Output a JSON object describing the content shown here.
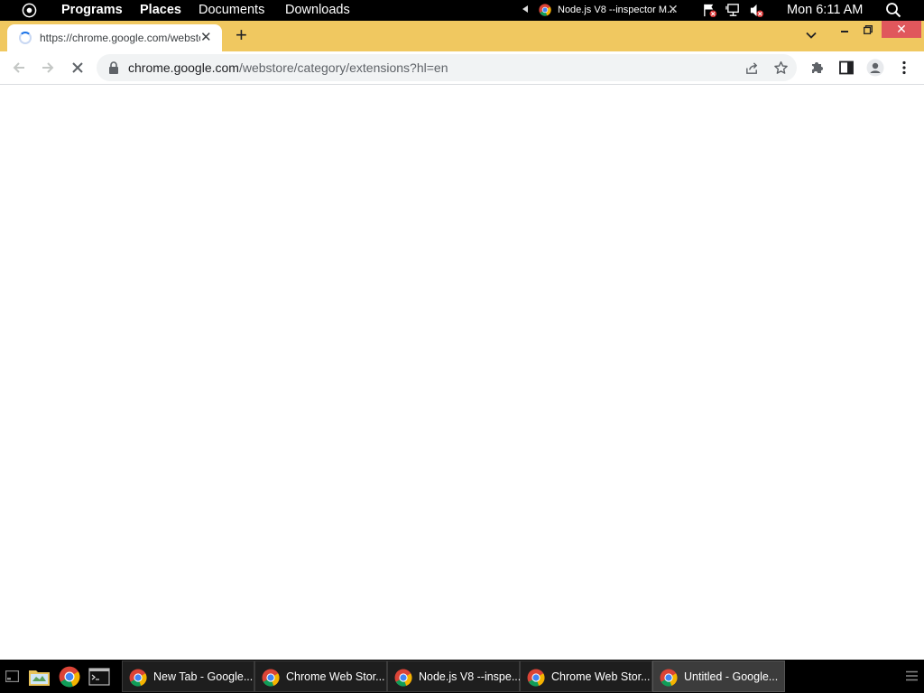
{
  "top_panel": {
    "menus": [
      "Programs",
      "Places",
      "Documents",
      "Downloads"
    ],
    "window_title": "Node.js V8 --inspector M...",
    "clock": "Mon 6:11 AM"
  },
  "browser": {
    "tab": {
      "title": "https://chrome.google.com/webstore/category/extensions?hl=en",
      "loading": true
    },
    "address_bar": {
      "domain": "chrome.google.com",
      "path": "/webstore/category/extensions?hl=en"
    }
  },
  "taskbar": {
    "tasks": [
      {
        "label": "New Tab - Google...",
        "active": false
      },
      {
        "label": "Chrome Web Stor...",
        "active": false
      },
      {
        "label": "Node.js V8 --inspe...",
        "active": false
      },
      {
        "label": "Chrome Web Stor...",
        "active": false
      },
      {
        "label": "Untitled - Google...",
        "active": true
      }
    ]
  },
  "colors": {
    "tab_strip": "#f0c860",
    "close_button": "#e0575c"
  }
}
